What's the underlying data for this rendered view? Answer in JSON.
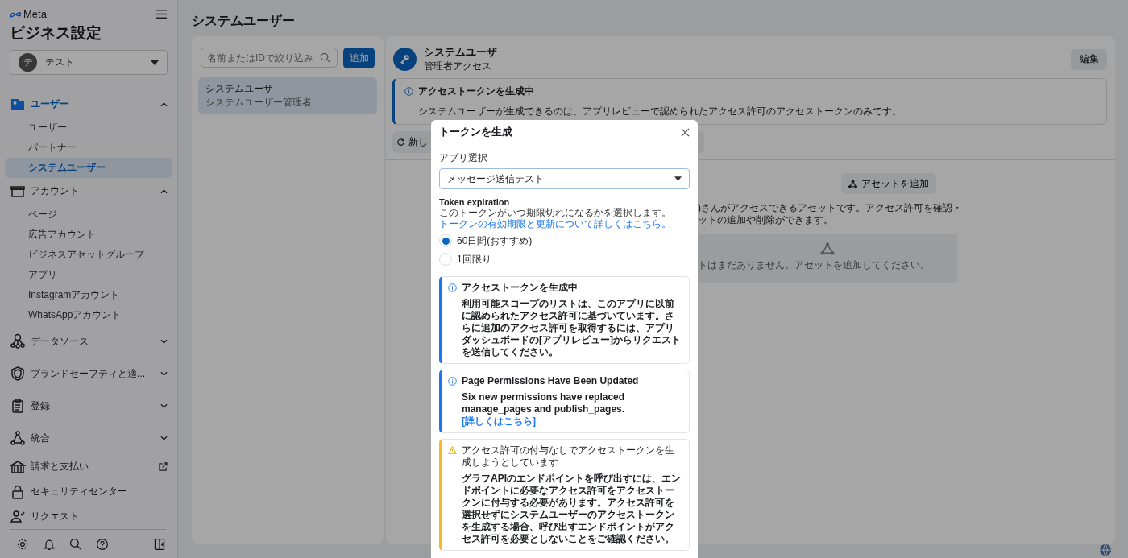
{
  "sidebar": {
    "brand": "Meta",
    "title": "ビジネス設定",
    "account": {
      "avatar": "テ",
      "name": "テスト"
    },
    "sections": [
      {
        "label": "ユーザー",
        "kind": "users",
        "expanded": true,
        "selected": true,
        "children": [
          {
            "label": "ユーザー",
            "selected": false
          },
          {
            "label": "パートナー",
            "selected": false
          },
          {
            "label": "システムユーザー",
            "selected": true
          }
        ]
      },
      {
        "label": "アカウント",
        "kind": "accounts",
        "expanded": true,
        "selected": false,
        "children": [
          {
            "label": "ページ",
            "selected": false
          },
          {
            "label": "広告アカウント",
            "selected": false
          },
          {
            "label": "ビジネスアセットグループ",
            "selected": false
          },
          {
            "label": "アプリ",
            "selected": false
          },
          {
            "label": "Instagramアカウント",
            "selected": false
          },
          {
            "label": "WhatsAppアカウント",
            "selected": false
          }
        ]
      },
      {
        "label": "データソース",
        "kind": "data",
        "expanded": false,
        "selected": false
      },
      {
        "label": "ブランドセーフティと適...",
        "kind": "shield",
        "expanded": false,
        "selected": false
      },
      {
        "label": "登録",
        "kind": "clipboard",
        "expanded": false,
        "selected": false
      },
      {
        "label": "統合",
        "kind": "integration",
        "expanded": false,
        "selected": false
      },
      {
        "label": "請求と支払い",
        "kind": "bank",
        "external": true,
        "selected": false
      },
      {
        "label": "セキュリティセンター",
        "kind": "lock",
        "selected": false
      },
      {
        "label": "リクエスト",
        "kind": "request",
        "selected": false
      }
    ]
  },
  "page_title": "システムユーザー",
  "user_list": {
    "search_placeholder": "名前またはIDで絞り込み",
    "add_button": "追加",
    "users": [
      {
        "name": "システムユーザ",
        "role": "システムユーザー管理者",
        "selected": true
      }
    ]
  },
  "detail": {
    "name": "システムユーザ",
    "access": "管理者アクセス",
    "edit_button": "編集",
    "notice": {
      "title": "アクセストークンを生成中",
      "body": "システムユーザーが生成できるのは、アプリレビューで認められたアクセス許可のアクセストークンのみです。"
    },
    "generate_button": "新し",
    "add_asset_button": "アセットを追加",
    "description": [
      ")さんがアクセスできるアセットです。アクセス許可を確認・",
      "ットの追加や削除ができます。"
    ],
    "empty_text": "トはまだありません。アセットを追加してください。"
  },
  "modal": {
    "title": "トークンを生成",
    "app_select": {
      "label": "アプリ選択",
      "value": "メッセージ送信テスト"
    },
    "expiration": {
      "label": "Token expiration",
      "help": "このトークンがいつ期限切れになるかを選択します。",
      "link": "トークンの有効期限と更新について詳しくはこちら。",
      "options": [
        {
          "label": "60日間(おすすめ)",
          "selected": true
        },
        {
          "label": "1回限り",
          "selected": false
        }
      ]
    },
    "notices": [
      {
        "kind": "info",
        "title": "アクセストークンを生成中",
        "body": "利用可能スコープのリストは、このアプリに以前に認められたアクセス許可に基づいています。さらに追加のアクセス許可を取得するには、アプリダッシュボードの[アプリレビュー]からリクエストを送信してください。"
      },
      {
        "kind": "info",
        "title": "Page Permissions Have Been Updated",
        "body": "Six new permissions have replaced manage_pages and publish_pages.",
        "link": "[詳しくはこちら]"
      },
      {
        "kind": "warning",
        "title": "アクセス許可の付与なしでアクセストークンを生成しようとしています",
        "body": "グラフAPIのエンドポイントを呼び出すには、エンドポイントに必要なアクセス許可をアクセストークンに付与する必要があります。アクセス許可を選択せずにシステムユーザーのアクセストークンを生成する場合、呼び出すエンドポイントがアクセス許可を必要としないことをご確認ください。"
      }
    ]
  }
}
